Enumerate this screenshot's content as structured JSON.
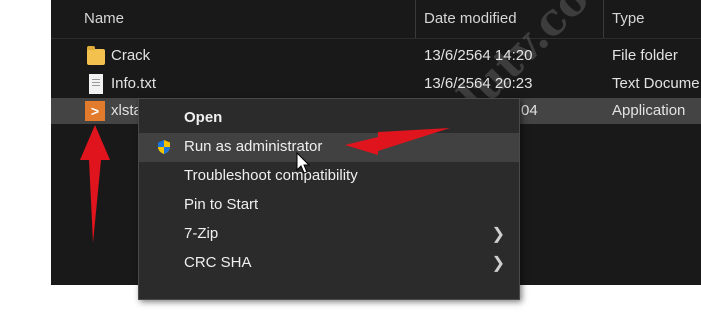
{
  "columns": {
    "name": "Name",
    "date": "Date modified",
    "type": "Type"
  },
  "files": [
    {
      "name": "Crack",
      "date": "13/6/2564 14:20",
      "type": "File folder",
      "icon": "folder-icon"
    },
    {
      "name": "Info.txt",
      "date": "13/6/2564 20:23",
      "type": "Text Docume",
      "icon": "text-file-icon"
    },
    {
      "name": "xlsta",
      "date": "04",
      "type": "Application",
      "icon": "app-icon"
    }
  ],
  "app_icon_glyph": ">",
  "context_menu": [
    {
      "label": "Open",
      "bold": true
    },
    {
      "label": "Run as administrator",
      "icon": "shield-icon",
      "highlighted": true
    },
    {
      "label": "Troubleshoot compatibility"
    },
    {
      "label": "Pin to Start"
    },
    {
      "label": "7-Zip",
      "submenu": true
    },
    {
      "label": "CRC SHA",
      "submenu": true
    }
  ],
  "submenu_glyph": "❯",
  "watermark": "nadutv.com",
  "colors": {
    "background": "#191919",
    "selected_row": "#444444",
    "menu": "#2b2b2b",
    "annotation_arrow": "#e0141c",
    "app_icon": "#e27b2b",
    "folder": "#f2c14e"
  }
}
